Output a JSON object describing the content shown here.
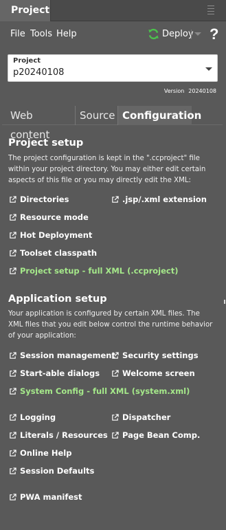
{
  "titlebar": {
    "title": "Project",
    "menu_icon": "hamburger-icon"
  },
  "menubar": {
    "file": "File",
    "tools": "Tools",
    "help": "Help",
    "deploy": "Deploy",
    "deploy_icon": "refresh-icon",
    "help_icon_text": "?"
  },
  "project": {
    "label": "Project",
    "value": "p20240108"
  },
  "version": {
    "label": "Version",
    "value": "20240108"
  },
  "tabs": [
    {
      "label": "Web content",
      "active": false
    },
    {
      "label": "Source",
      "active": false
    },
    {
      "label": "Configuration",
      "active": true
    }
  ],
  "project_setup": {
    "title": "Project setup",
    "description": "The project configuration is kept in the \".ccproject\" file within your project directory. You may either edit certain aspects of this file or you may directly edit the XML:",
    "links": {
      "directories": "Directories",
      "jsp_xml": ".jsp/.xml extension",
      "resource_mode": "Resource mode",
      "hot_deployment": "Hot Deployment",
      "toolset_classpath": "Toolset classpath",
      "full_xml": "Project setup - full XML (.ccproject)"
    }
  },
  "application_setup": {
    "title": "Application setup",
    "description": "Your application is configured by certain XML files. The XML files that you edit below control the runtime behavior of your application:",
    "links": {
      "session_management": "Session management",
      "security_settings": "Security settings",
      "startable_dialogs": "Start-able dialogs",
      "welcome_screen": "Welcome screen",
      "system_config": "System Config - full XML (system.xml)",
      "logging": "Logging",
      "dispatcher": "Dispatcher",
      "literals": "Literals / Resources",
      "page_bean": "Page Bean Comp.",
      "online_help": "Online Help",
      "session_defaults": "Session Defaults",
      "pwa_manifest": "PWA manifest"
    }
  },
  "colors": {
    "background": "#595959",
    "accent_link": "#a5e88a",
    "deploy_icon": "#4cc24c"
  }
}
